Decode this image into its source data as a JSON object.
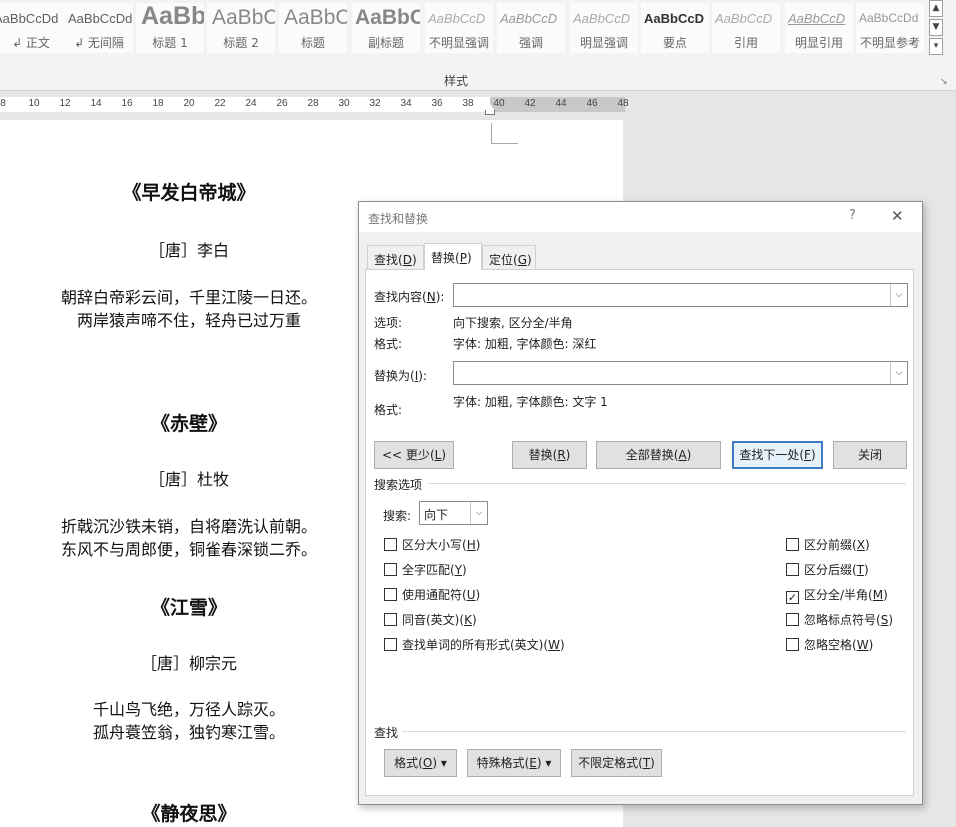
{
  "ribbon": {
    "styles": [
      {
        "preview": "AaBbCcDd",
        "name": "↲ 正文",
        "kind": ""
      },
      {
        "preview": "AaBbCcDd",
        "name": "↲ 无间隔",
        "kind": ""
      },
      {
        "preview": "AaBb",
        "name": "标题 1",
        "kind": "title"
      },
      {
        "preview": "AaBbC",
        "name": "标题 2",
        "kind": "h2"
      },
      {
        "preview": "AaBbC",
        "name": "标题",
        "kind": "h"
      },
      {
        "preview": "AaBbC",
        "name": "副标题",
        "kind": "sub"
      },
      {
        "preview": "AaBbCcD",
        "name": "不明显强调",
        "kind": "light"
      },
      {
        "preview": "AaBbCcD",
        "name": "强调",
        "kind": "em"
      },
      {
        "preview": "AaBbCcD",
        "name": "明显强调",
        "kind": "light"
      },
      {
        "preview": "AaBbCcD",
        "name": "要点",
        "kind": "bold"
      },
      {
        "preview": "AaBbCcD",
        "name": "引用",
        "kind": "light"
      },
      {
        "preview": "AaBbCcD",
        "name": "明显引用",
        "kind": "quote"
      },
      {
        "preview": "AaBbCcDd",
        "name": "不明显参考",
        "kind": "sref"
      }
    ],
    "group_label": "样式",
    "scroll_up": "▲",
    "scroll_down": "▼",
    "more": "▾",
    "launcher": "↘"
  },
  "ruler": {
    "numbers": [
      "8",
      "10",
      "12",
      "14",
      "16",
      "18",
      "20",
      "22",
      "24",
      "26",
      "28",
      "30",
      "32",
      "34",
      "36",
      "38",
      "40",
      "42",
      "44",
      "46",
      "48"
    ]
  },
  "document": {
    "lines": [
      {
        "text": "《早发白帝城》",
        "kind": "title"
      },
      {
        "text": "［唐］李白",
        "kind": "author"
      },
      {
        "text": "朝辞白帝彩云间，千里江陵一日还。",
        "kind": "verse"
      },
      {
        "text": "两岸猿声啼不住，轻舟已过万重",
        "kind": "verse"
      },
      {
        "text": "《赤壁》",
        "kind": "title"
      },
      {
        "text": "［唐］杜牧",
        "kind": "author"
      },
      {
        "text": "折戟沉沙铁未销，自将磨洗认前朝。",
        "kind": "verse"
      },
      {
        "text": "东风不与周郎便，铜雀春深锁二乔。",
        "kind": "verse"
      },
      {
        "text": "《江雪》",
        "kind": "title"
      },
      {
        "text": "［唐］柳宗元",
        "kind": "author"
      },
      {
        "text": "千山鸟飞绝，万径人踪灭。",
        "kind": "verse"
      },
      {
        "text": "孤舟蓑笠翁，独钓寒江雪。",
        "kind": "verse"
      },
      {
        "text": "《静夜思》",
        "kind": "title"
      }
    ]
  },
  "dialog": {
    "title": "查找和替换",
    "help": "?",
    "close": "✕",
    "tabs": [
      {
        "label": "查找",
        "key": "D",
        "active": false
      },
      {
        "label": "替换",
        "key": "P",
        "active": true
      },
      {
        "label": "定位",
        "key": "G",
        "active": false
      }
    ],
    "find_label": "查找内容",
    "find_key": "N",
    "find_value": "",
    "options_label": "选项:",
    "options_value": "向下搜索, 区分全/半角",
    "find_format_label": "格式:",
    "find_format_value": "字体: 加粗, 字体颜色: 深红",
    "replace_label": "替换为",
    "replace_key": "I",
    "replace_value": "",
    "replace_format_label": "格式:",
    "replace_format_value": "字体: 加粗, 字体颜色: 文字 1",
    "buttons": {
      "less": "<< 更少",
      "less_key": "L",
      "replace": "替换",
      "replace_key": "R",
      "replace_all": "全部替换",
      "replace_all_key": "A",
      "find_next": "查找下一处",
      "find_next_key": "F",
      "close": "关闭"
    },
    "search_options_title": "搜索选项",
    "search_label": "搜索",
    "search_key": "",
    "search_value": "向下",
    "left_options": [
      {
        "label": "区分大小写",
        "key": "H",
        "checked": false
      },
      {
        "label": "全字匹配",
        "key": "Y",
        "checked": false
      },
      {
        "label": "使用通配符",
        "key": "U",
        "checked": false
      },
      {
        "label": "同音(英文)",
        "key": "K",
        "checked": false
      },
      {
        "label": "查找单词的所有形式(英文)",
        "key": "W",
        "checked": false
      }
    ],
    "right_options": [
      {
        "label": "区分前缀",
        "key": "X",
        "checked": false
      },
      {
        "label": "区分后缀",
        "key": "T",
        "checked": false
      },
      {
        "label": "区分全/半角",
        "key": "M",
        "checked": true
      },
      {
        "label": "忽略标点符号",
        "key": "S",
        "checked": false
      },
      {
        "label": "忽略空格",
        "key": "W",
        "checked": false
      }
    ],
    "find_section": "查找",
    "format_btn": "格式",
    "format_key": "O",
    "special_btn": "特殊格式",
    "special_key": "E",
    "no_format_btn": "不限定格式",
    "no_format_key": "T",
    "dropdown_arrow": "▾"
  }
}
